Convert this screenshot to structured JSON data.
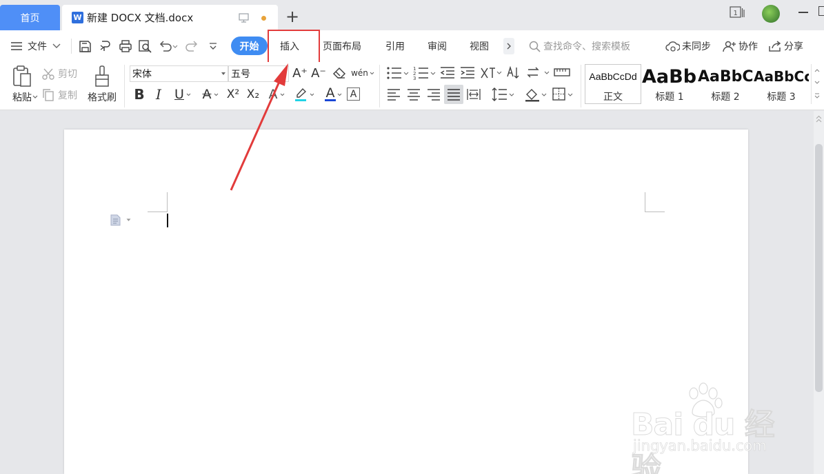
{
  "tabs": {
    "home_label": "首页",
    "doc_title": "新建 DOCX 文档.docx",
    "doc_logo": "W"
  },
  "menubar": {
    "file_label": "文件",
    "tabs": [
      {
        "label": "开始",
        "active": true
      },
      {
        "label": "插入",
        "highlighted": true
      },
      {
        "label": "页面布局"
      },
      {
        "label": "引用"
      },
      {
        "label": "审阅"
      },
      {
        "label": "视图"
      }
    ],
    "search_placeholder": "查找命令、搜索模板",
    "sync_label": "未同步",
    "collab_label": "协作",
    "share_label": "分享"
  },
  "ribbon": {
    "paste_label": "粘贴",
    "cut_label": "剪切",
    "copy_label": "复制",
    "format_painter_label": "格式刷",
    "font_name": "宋体",
    "font_size": "五号",
    "phonetic_label": "wén",
    "bold_glyph": "B",
    "italic_glyph": "I",
    "underline_glyph": "U",
    "strike_glyph": "A",
    "superscript_glyph": "X²",
    "subscript_glyph": "X₂",
    "text_effect_glyph": "A",
    "font_color_glyph": "A",
    "char_border_glyph": "A",
    "grow_glyph": "A⁺",
    "shrink_glyph": "A⁻",
    "styles": [
      {
        "sample": "AaBbCcDd",
        "name": "正文"
      },
      {
        "sample": "AaBb",
        "name": "标题 1"
      },
      {
        "sample": "AaBbC",
        "name": "标题 2"
      },
      {
        "sample": "AaBbCc",
        "name": "标题 3"
      }
    ]
  },
  "watermark": {
    "brand": "Bai du 经验",
    "url": "jingyan.baidu.com"
  },
  "colors": {
    "accent": "#3f8cf2",
    "home_tab": "#4f8ff7",
    "annotation_red": "#e23b3b",
    "highlight_cyan": "#22d3e6",
    "font_red": "#e02020"
  },
  "icons": [
    "hamburger-icon",
    "save-icon",
    "format-icon",
    "print-icon",
    "print-preview-icon",
    "undo-icon",
    "redo-icon",
    "more-icon",
    "search-icon",
    "cloud-sync-icon",
    "collab-icon",
    "share-icon",
    "paste-icon",
    "scissors-icon",
    "copy-icon",
    "brush-icon",
    "eraser-icon",
    "bullets-icon",
    "numbering-icon",
    "indent-icon",
    "outdent-icon",
    "sort-icon",
    "align-left-icon",
    "align-center-icon",
    "align-right-icon",
    "justify-icon",
    "distribute-icon",
    "line-spacing-icon",
    "shading-icon",
    "border-icon"
  ]
}
